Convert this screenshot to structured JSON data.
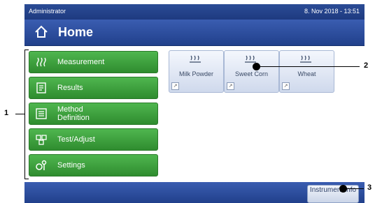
{
  "statusbar": {
    "user": "Administrator",
    "datetime": "8. Nov 2018 - 13:51"
  },
  "header": {
    "title": "Home"
  },
  "nav": [
    {
      "label": "Measurement",
      "icon": "measurement-icon"
    },
    {
      "label": "Results",
      "icon": "results-icon"
    },
    {
      "label": "Method\nDefinition",
      "icon": "method-definition-icon"
    },
    {
      "label": "Test/Adjust",
      "icon": "test-adjust-icon"
    },
    {
      "label": "Settings",
      "icon": "settings-icon"
    }
  ],
  "shortcuts": [
    {
      "label": "Milk Powder"
    },
    {
      "label": "Sweet Corn"
    },
    {
      "label": "Wheat"
    }
  ],
  "footer": {
    "info_label": "Instrument info"
  },
  "callouts": {
    "c1": "1",
    "c2": "2",
    "c3": "3"
  },
  "colors": {
    "header_blue": "#2b4c96",
    "nav_green": "#3fa63f",
    "tile_blue": "#dfe6f4"
  }
}
